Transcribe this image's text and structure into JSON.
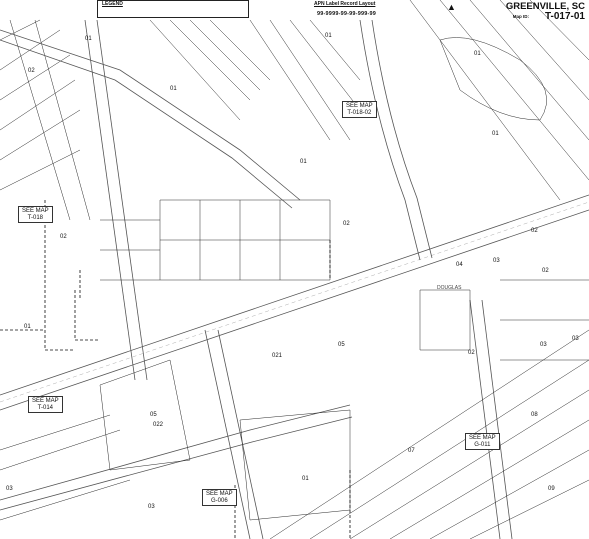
{
  "header": {
    "legend_title": "LEGEND",
    "apn_title": "APN Label Record Layout",
    "apn_example": "99-9999-99-99-999-99",
    "city": "GREENVILLE, SC",
    "map_id_label": "Map ID:",
    "map_id": "T-017-01"
  },
  "see_maps": [
    {
      "line1": "SEE MAP",
      "line2": "T-018-02"
    },
    {
      "line1": "SEE MAP",
      "line2": "T-018"
    },
    {
      "line1": "SEE MAP",
      "line2": "T-014"
    },
    {
      "line1": "SEE MAP",
      "line2": "G-006"
    },
    {
      "line1": "SEE MAP",
      "line2": "G-011"
    }
  ],
  "parcels": [
    "01",
    "01",
    "02",
    "01",
    "01",
    "02",
    "02",
    "01",
    "05",
    "05",
    "07",
    "01",
    "03",
    "02",
    "04",
    "03",
    "02",
    "03",
    "08",
    "09",
    "03",
    "02",
    "021",
    "022",
    "03",
    "02"
  ],
  "road_labels": [
    "DOUGLAS"
  ],
  "colors": {
    "line": "#2b2b2b",
    "road_edge": "#555555",
    "dashed": "#111111"
  }
}
